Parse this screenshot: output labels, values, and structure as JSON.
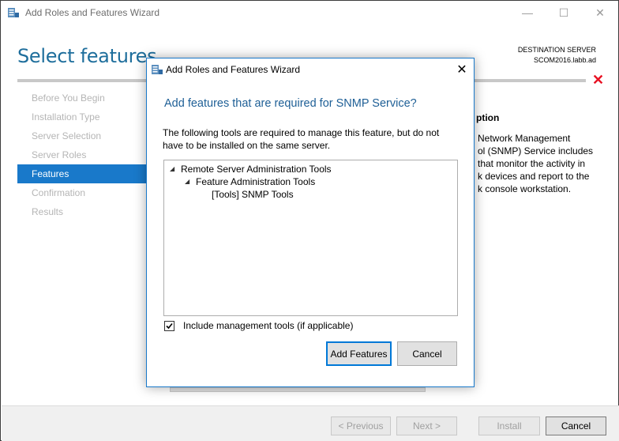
{
  "window": {
    "title": "Add Roles and Features Wizard",
    "minimize_glyph": "—",
    "maximize_glyph": "☐",
    "close_glyph": "✕"
  },
  "page": {
    "title": "Select features",
    "destination_label": "DESTINATION SERVER",
    "destination_server": "SCOM2016.labb.ad",
    "error_glyph": "✕"
  },
  "nav": {
    "items": [
      {
        "label": "Before You Begin"
      },
      {
        "label": "Installation Type"
      },
      {
        "label": "Server Selection"
      },
      {
        "label": "Server Roles"
      },
      {
        "label": "Features"
      },
      {
        "label": "Confirmation"
      },
      {
        "label": "Results"
      }
    ],
    "active_index": 4
  },
  "description": {
    "title": "ption",
    "lines": [
      "Network Management",
      "ol (SNMP) Service includes",
      "that monitor the activity in",
      "k devices and report to the",
      "k console workstation."
    ]
  },
  "footer": {
    "previous_label": "< Previous",
    "next_label": "Next >",
    "install_label": "Install",
    "cancel_label": "Cancel"
  },
  "dialog": {
    "title": "Add Roles and Features Wizard",
    "close_glyph": "✕",
    "heading": "Add features that are required for SNMP Service?",
    "body_line1": "The following tools are required to manage this feature, but do not",
    "body_line2": "have to be installed on the same server.",
    "tree": [
      {
        "label": "Remote Server Administration Tools",
        "expanded": true
      },
      {
        "label": "Feature Administration Tools",
        "expanded": true
      },
      {
        "label": "[Tools] SNMP Tools"
      }
    ],
    "tree_arrow_glyph": "◢",
    "checkbox_label": "Include management tools (if applicable)",
    "checkbox_checked": true,
    "add_button": "Add Features",
    "cancel_button": "Cancel"
  },
  "colors": {
    "accent": "#1979ca",
    "title_blue": "#1e6e9c",
    "error_red": "#e81123"
  }
}
